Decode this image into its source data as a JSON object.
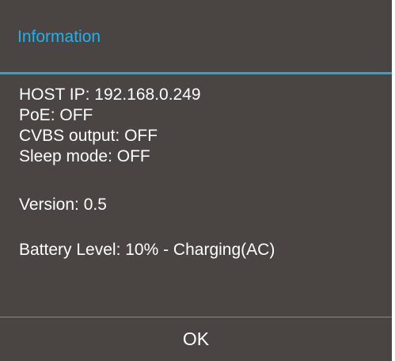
{
  "dialog": {
    "title": "Information",
    "lines": [
      "HOST IP: 192.168.0.249",
      "PoE: OFF",
      "CVBS output: OFF",
      "Sleep mode: OFF",
      "Version: 0.5",
      "Battery Level: 10% - Charging(AC)"
    ],
    "ok_label": "OK"
  },
  "colors": {
    "background": "#4a4542",
    "accent": "#1fa9e1",
    "text": "#ffffff"
  }
}
